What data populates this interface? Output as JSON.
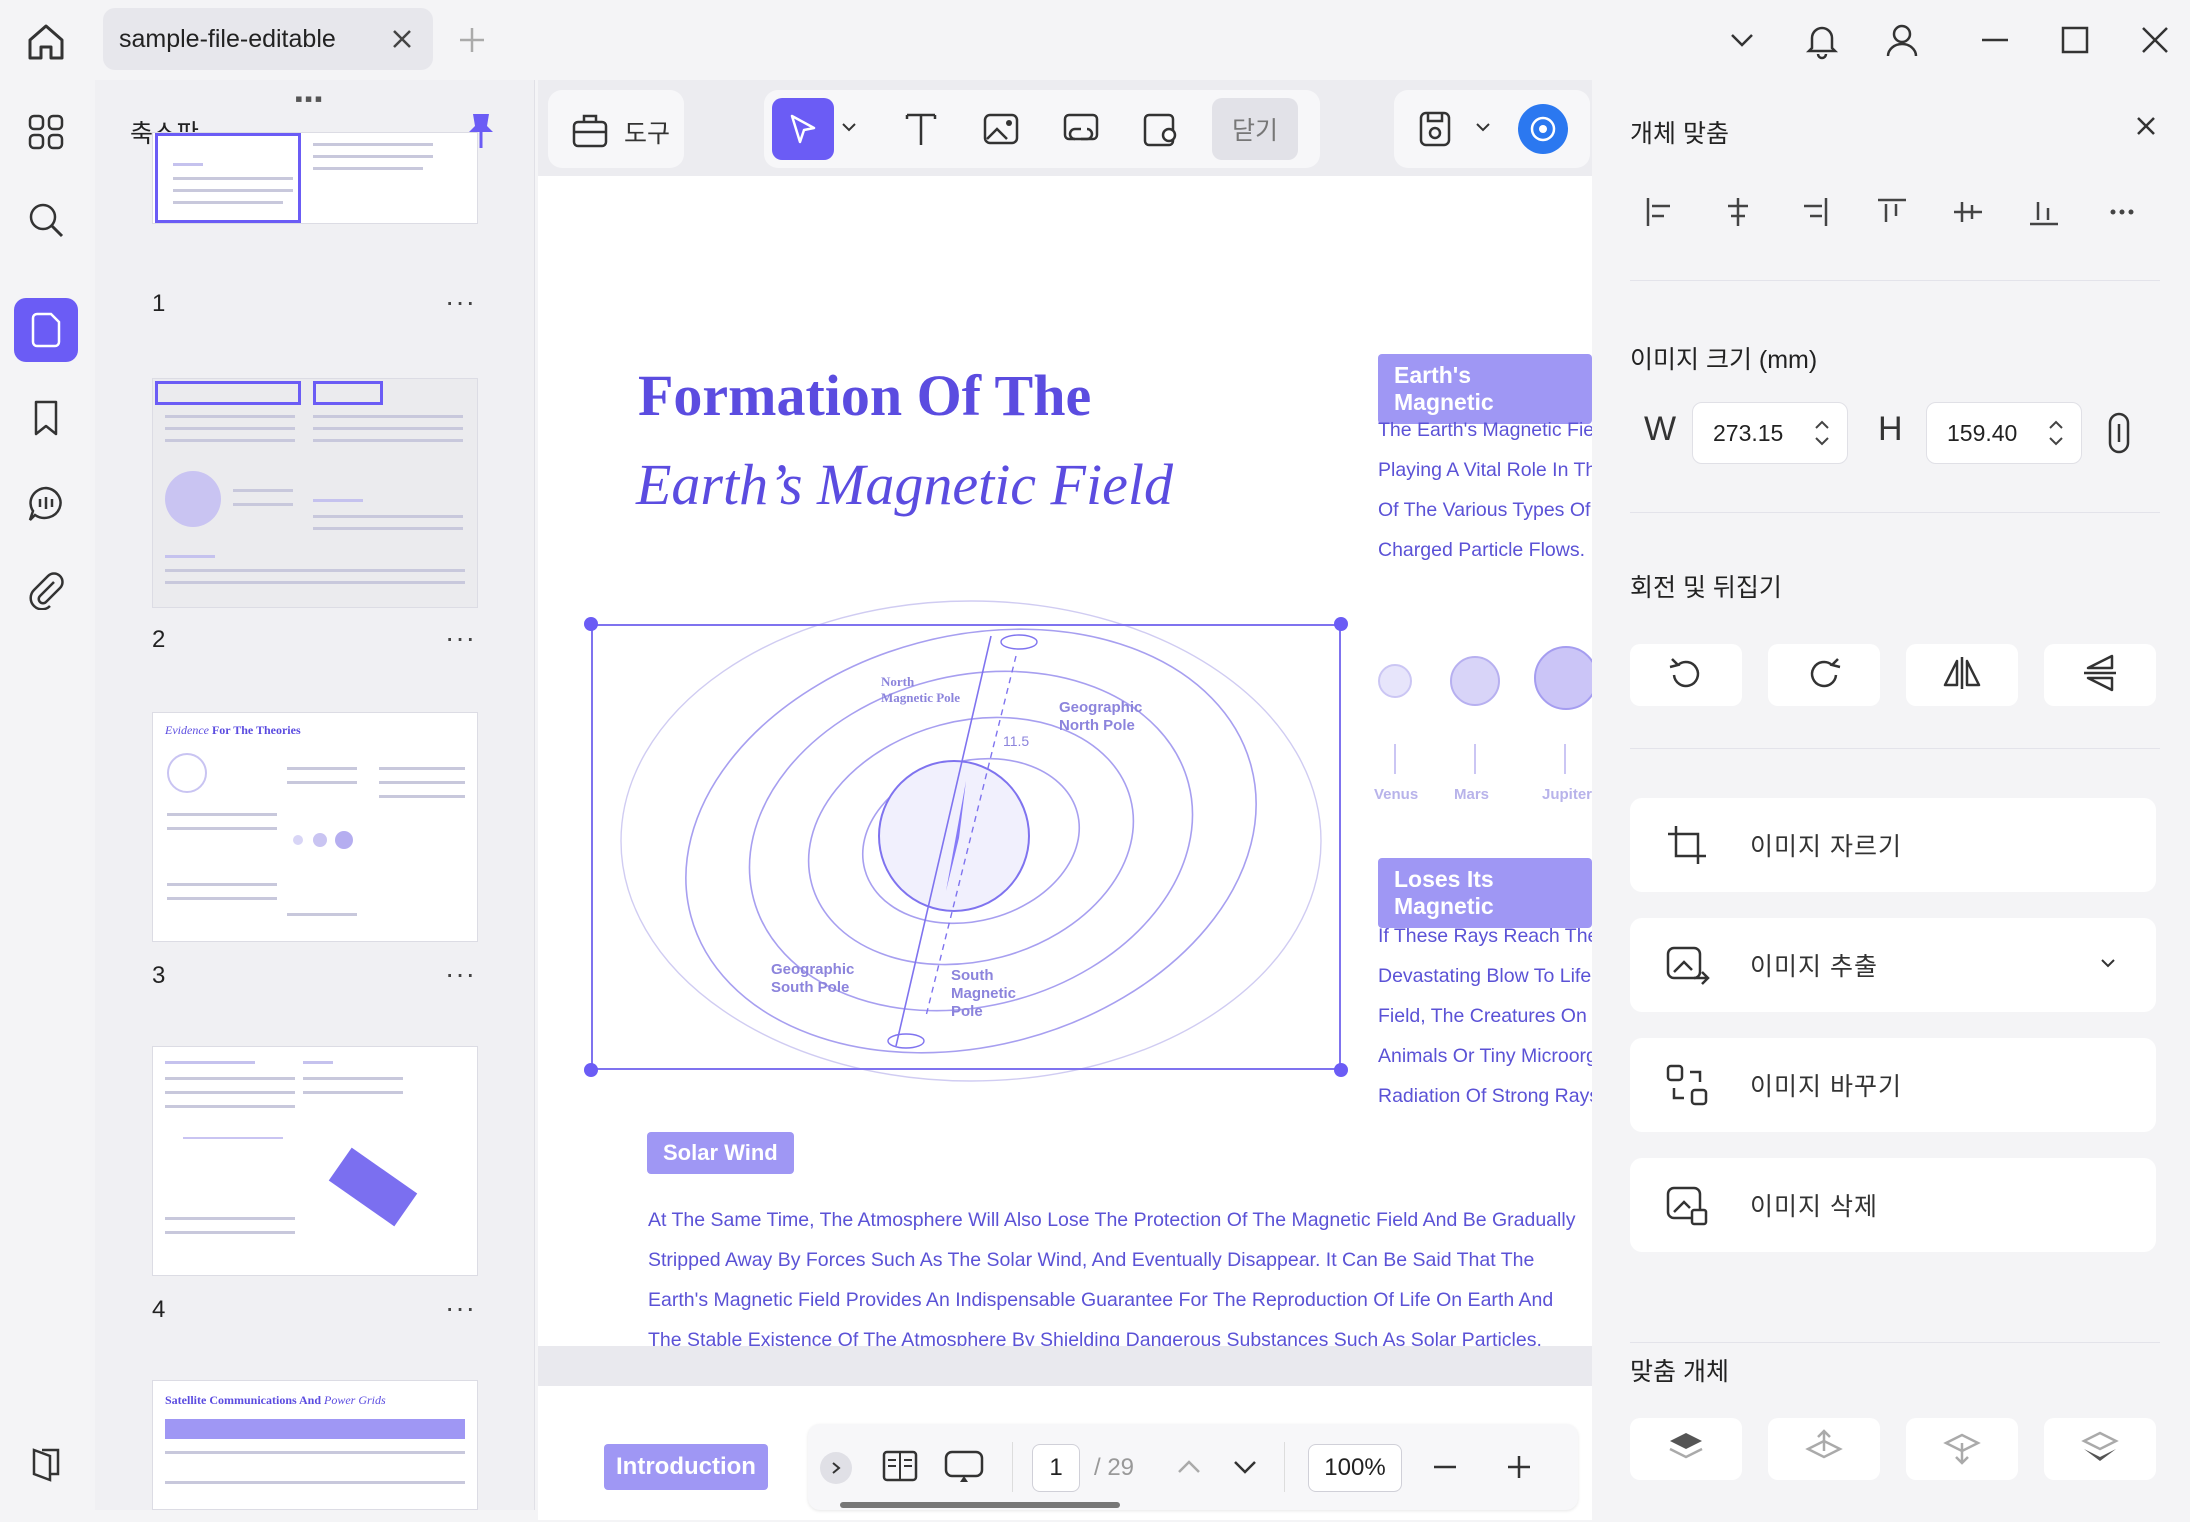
{
  "tab": {
    "title": "sample-file-editable"
  },
  "thumbnails": {
    "title": "축소판",
    "pages": [
      {
        "num": "1"
      },
      {
        "num": "2"
      },
      {
        "num": "3"
      },
      {
        "num": "4"
      }
    ],
    "more": "···",
    "page3_heading_italic": "Evidence",
    "page3_heading": "For The Theories",
    "page5_heading": "Satellite Communications And",
    "page5_heading_italic": "Power Grids"
  },
  "toolbar": {
    "tools_label": "도구",
    "close_label": "닫기"
  },
  "document": {
    "title_line1": "Formation Of The",
    "title_line2": "Earth’s Magnetic Field",
    "section1_heading": "Earth's Magnetic",
    "section1_lines": [
      "The Earth's Magnetic Fiel",
      "Playing A Vital Role In Th",
      "Of The Various Types Of",
      "Charged Particle Flows."
    ],
    "planets": [
      "Venus",
      "Mars",
      "Jupiter"
    ],
    "section2_heading": "Loses Its Magnetic",
    "section2_lines": [
      "If These Rays Reach The",
      "Devastating Blow To Life",
      "Field, The Creatures On T",
      "Animals Or Tiny Microorga",
      "Radiation Of Strong Rays"
    ],
    "diagram_labels": {
      "north_magnetic": "North\nMagnetic Pole",
      "geographic_north": "Geographic\nNorth Pole",
      "angle": "11.5",
      "geographic_south": "Geographic\nSouth Pole",
      "south_magnetic": "South\nMagnetic\nPole"
    },
    "solar_heading": "Solar Wind",
    "solar_lines": [
      "At The Same Time, The Atmosphere Will Also Lose The Protection Of The Magnetic Field And Be Gradually",
      "Stripped Away By Forces Such As The Solar Wind, And Eventually Disappear. It Can Be Said That The",
      "Earth's Magnetic Field Provides An Indispensable Guarantee For The Reproduction Of Life On Earth And",
      "The Stable Existence Of The Atmosphere By Shielding Dangerous Substances Such As Solar Particles."
    ],
    "intro_pill": "Introduction"
  },
  "pager": {
    "current": "1",
    "total": "/ 29",
    "zoom": "100%"
  },
  "right_panel": {
    "align_title": "개체 맞춤",
    "size_title": "이미지 크기 (mm)",
    "width_label": "W",
    "width_value": "273.15",
    "height_label": "H",
    "height_value": "159.40",
    "rotate_title": "회전 및 뒤집기",
    "actions": [
      "이미지 자르기",
      "이미지 추출",
      "이미지 바꾸기",
      "이미지 삭제"
    ],
    "arrange_title": "맞춤 개체"
  },
  "colors": {
    "accent": "#6b5cf5",
    "doc_primary": "#5b4ce0",
    "pill": "#9f97f4"
  }
}
